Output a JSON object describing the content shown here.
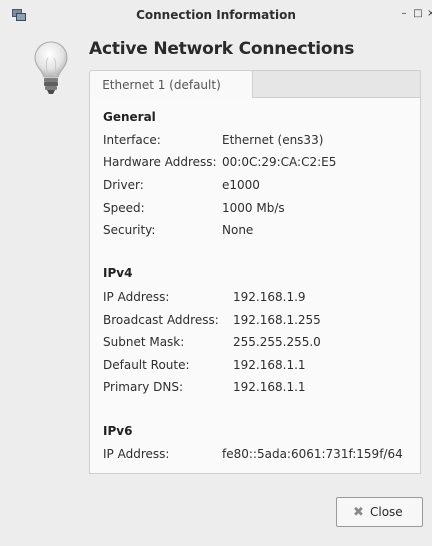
{
  "window": {
    "title": "Connection Information",
    "minimize_glyph": "–",
    "maximize_glyph": "□",
    "close_glyph": "×"
  },
  "heading": "Active Network Connections",
  "tabs": [
    {
      "label": "Ethernet 1 (default)",
      "selected": true
    }
  ],
  "sections": [
    {
      "title": "General",
      "rows": [
        {
          "label": "Interface:",
          "value": "Ethernet (ens33)"
        },
        {
          "label": "Hardware Address:",
          "value": "00:0C:29:CA:C2:E5"
        },
        {
          "label": "Driver:",
          "value": "e1000"
        },
        {
          "label": "Speed:",
          "value": "1000 Mb/s"
        },
        {
          "label": "Security:",
          "value": "None"
        }
      ]
    },
    {
      "title": "IPv4",
      "rows": [
        {
          "label": "IP Address:",
          "value": "192.168.1.9"
        },
        {
          "label": "Broadcast Address:",
          "value": "192.168.1.255"
        },
        {
          "label": "Subnet Mask:",
          "value": "255.255.255.0"
        },
        {
          "label": "Default Route:",
          "value": "192.168.1.1"
        },
        {
          "label": "Primary DNS:",
          "value": "192.168.1.1"
        }
      ]
    },
    {
      "title": "IPv6",
      "rows": [
        {
          "label": "IP Address:",
          "value": "fe80::5ada:6061:731f:159f/64"
        }
      ]
    }
  ],
  "buttons": {
    "close_label": "Close",
    "close_icon": "✖"
  },
  "icons": {
    "app": "network-icon",
    "bulb": "lightbulb-icon",
    "close": "close-x-icon"
  }
}
